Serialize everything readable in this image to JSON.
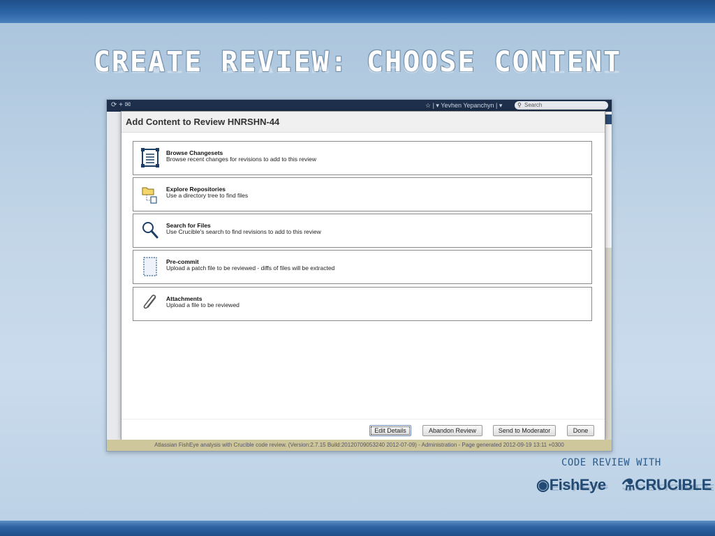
{
  "slide": {
    "title": "CREATE REVIEW: CHOOSE CONTENT",
    "tagline": "CODE REVIEW WITH",
    "logo_fisheye": "FishEye",
    "logo_crucible": "CRUCIBLE"
  },
  "app": {
    "header_user": "Yevhen Yepanchyn",
    "search_placeholder": "Search",
    "footer_text": "Atlassian FishEye analysis with Crucible code review. (Version:2.7.15 Build:20120709053240 2012-07-09) - Administration - Page generated 2012-09-19 13:11 +0300"
  },
  "dialog": {
    "title": "Add Content to Review HNRSHN-44",
    "options": [
      {
        "icon": "changesets-icon",
        "title": "Browse Changesets",
        "desc": "Browse recent changes for revisions to add to this review"
      },
      {
        "icon": "folder-tree-icon",
        "title": "Explore Repositories",
        "desc": "Use a directory tree to find files"
      },
      {
        "icon": "magnifier-icon",
        "title": "Search for Files",
        "desc": "Use Crucible's search to find revisions to add to this review"
      },
      {
        "icon": "patch-file-icon",
        "title": "Pre-commit",
        "desc": "Upload a patch file to be reviewed - diffs of files will be extracted"
      },
      {
        "icon": "paperclip-icon",
        "title": "Attachments",
        "desc": "Upload a file to be reviewed"
      }
    ],
    "buttons": {
      "edit_details": "Edit Details",
      "abandon": "Abandon Review",
      "send_moderator": "Send to Moderator",
      "done": "Done"
    }
  }
}
